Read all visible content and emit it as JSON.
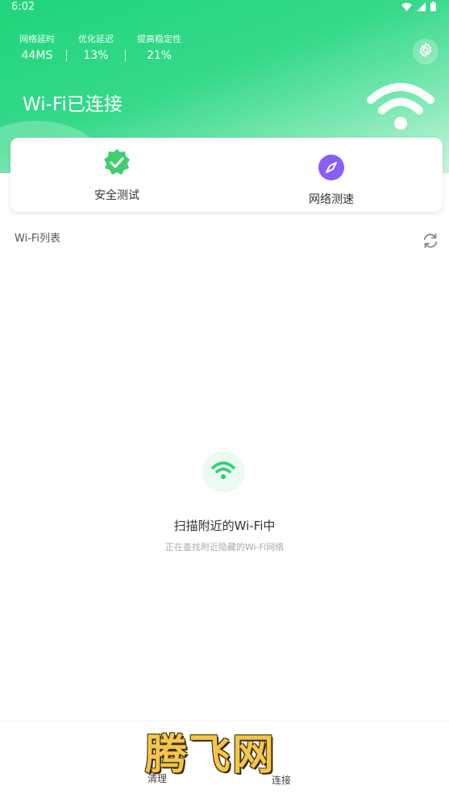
{
  "status_bar": {
    "time": "6:02"
  },
  "header": {
    "stats": [
      {
        "label": "网络延时",
        "value": "44MS"
      },
      {
        "label": "优化延迟",
        "value": "13%"
      },
      {
        "label": "提高稳定性",
        "value": "21%"
      }
    ],
    "title": "Wi-Fi已连接"
  },
  "tools": [
    {
      "label": "安全测试",
      "icon": "shield-check-icon",
      "color": "#3fcf6f"
    },
    {
      "label": "网络测速",
      "icon": "compass-icon",
      "color": "#8b5cf6"
    }
  ],
  "wifi_list": {
    "title": "Wi-Fi列表"
  },
  "scan": {
    "title": "扫描附近的Wi-Fi中",
    "subtitle": "正在查找附近隐藏的Wi-Fi网络"
  },
  "bottom_nav": {
    "items": [
      "清理",
      "连接"
    ]
  },
  "watermark": "腾飞网",
  "colors": {
    "accent": "#1fd67c"
  }
}
